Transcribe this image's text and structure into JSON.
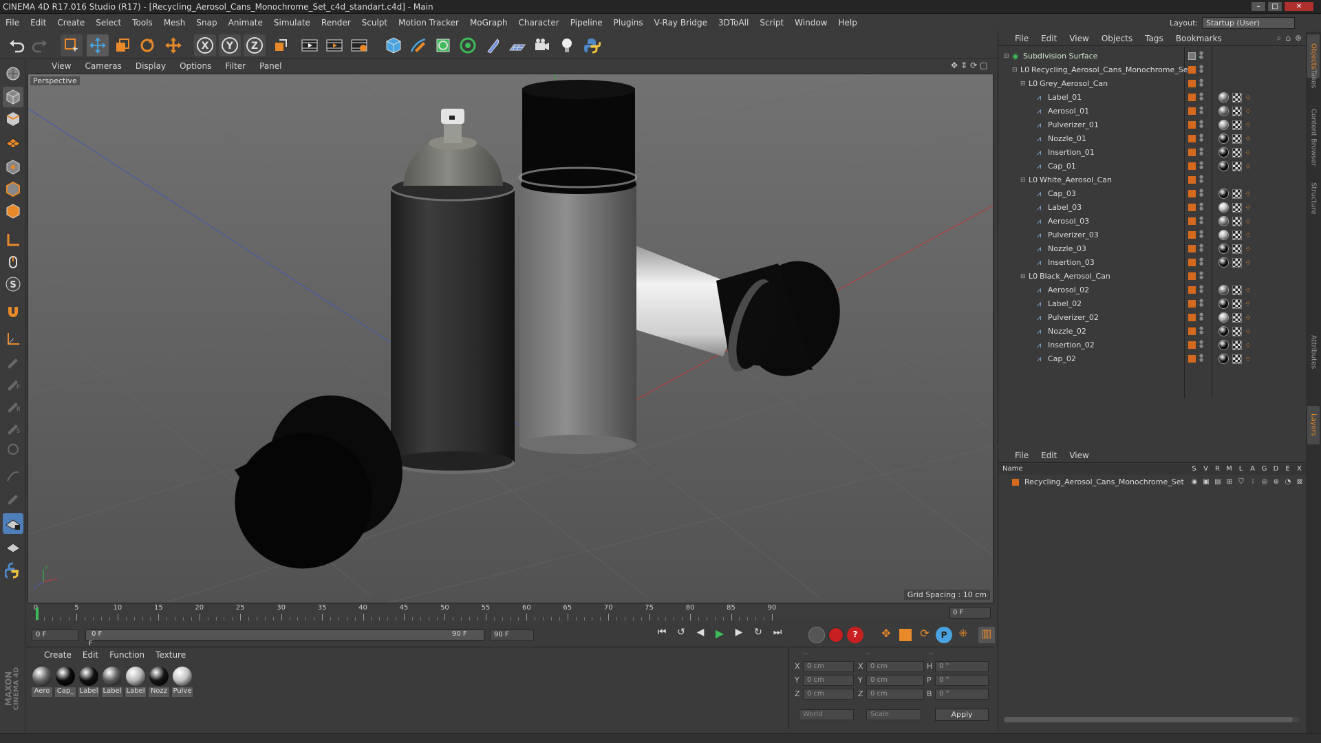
{
  "titlebar": {
    "title": "CINEMA 4D R17.016 Studio (R17) - [Recycling_Aerosol_Cans_Monochrome_Set_c4d_standart.c4d] - Main"
  },
  "menubar": [
    "File",
    "Edit",
    "Create",
    "Select",
    "Tools",
    "Mesh",
    "Snap",
    "Animate",
    "Simulate",
    "Render",
    "Sculpt",
    "Motion Tracker",
    "MoGraph",
    "Character",
    "Pipeline",
    "Plugins",
    "V-Ray Bridge",
    "3DToAll",
    "Script",
    "Window",
    "Help"
  ],
  "layout": {
    "label": "Layout:",
    "value": "Startup (User)"
  },
  "viewport": {
    "menu": [
      "View",
      "Cameras",
      "Display",
      "Options",
      "Filter",
      "Panel"
    ],
    "label": "Perspective",
    "grid_spacing": "Grid Spacing : 10 cm"
  },
  "timeline": {
    "ticks": [
      "0",
      "5",
      "10",
      "15",
      "20",
      "25",
      "30",
      "35",
      "40",
      "45",
      "50",
      "55",
      "60",
      "65",
      "70",
      "75",
      "80",
      "85",
      "90"
    ],
    "frame_field": "0 F"
  },
  "transport": {
    "start": "0 F",
    "range_start": "0 F",
    "range_end": "90 F",
    "end": "90 F"
  },
  "objects": {
    "menu": [
      "File",
      "Edit",
      "View",
      "Objects",
      "Tags",
      "Bookmarks"
    ],
    "tree": [
      {
        "name": "Subdivision Surface",
        "level": 0,
        "kind": "sds"
      },
      {
        "name": "Recycling_Aerosol_Cans_Monochrome_Set",
        "level": 1,
        "kind": "null"
      },
      {
        "name": "Grey_Aerosol_Can",
        "level": 2,
        "kind": "null"
      },
      {
        "name": "Label_01",
        "level": 3,
        "kind": "mesh",
        "tag": "#7a7a7a"
      },
      {
        "name": "Aerosol_01",
        "level": 3,
        "kind": "mesh",
        "tag": "#6a6a6a"
      },
      {
        "name": "Pulverizer_01",
        "level": 3,
        "kind": "mesh",
        "tag": "#9a9a9a"
      },
      {
        "name": "Nozzle_01",
        "level": 3,
        "kind": "mesh",
        "tag": "#111111"
      },
      {
        "name": "Insertion_01",
        "level": 3,
        "kind": "mesh",
        "tag": "#111111"
      },
      {
        "name": "Cap_01",
        "level": 3,
        "kind": "mesh",
        "tag": "#111111"
      },
      {
        "name": "White_Aerosol_Can",
        "level": 2,
        "kind": "null"
      },
      {
        "name": "Cap_03",
        "level": 3,
        "kind": "mesh",
        "tag": "#111111"
      },
      {
        "name": "Label_03",
        "level": 3,
        "kind": "mesh",
        "tag": "#bdbdbd"
      },
      {
        "name": "Aerosol_03",
        "level": 3,
        "kind": "mesh",
        "tag": "#777777"
      },
      {
        "name": "Pulverizer_03",
        "level": 3,
        "kind": "mesh",
        "tag": "#b0b0b0"
      },
      {
        "name": "Nozzle_03",
        "level": 3,
        "kind": "mesh",
        "tag": "#111111"
      },
      {
        "name": "Insertion_03",
        "level": 3,
        "kind": "mesh",
        "tag": "#111111"
      },
      {
        "name": "Black_Aerosol_Can",
        "level": 2,
        "kind": "null"
      },
      {
        "name": "Aerosol_02",
        "level": 3,
        "kind": "mesh",
        "tag": "#6a6a6a"
      },
      {
        "name": "Label_02",
        "level": 3,
        "kind": "mesh",
        "tag": "#111111"
      },
      {
        "name": "Pulverizer_02",
        "level": 3,
        "kind": "mesh",
        "tag": "#aaaaaa"
      },
      {
        "name": "Nozzle_02",
        "level": 3,
        "kind": "mesh",
        "tag": "#111111"
      },
      {
        "name": "Insertion_02",
        "level": 3,
        "kind": "mesh",
        "tag": "#111111"
      },
      {
        "name": "Cap_02",
        "level": 3,
        "kind": "mesh",
        "tag": "#111111"
      }
    ]
  },
  "layers": {
    "menu": [
      "File",
      "Edit",
      "View"
    ],
    "header": {
      "name": "Name",
      "cols": [
        "S",
        "V",
        "R",
        "M",
        "L",
        "A",
        "G",
        "D",
        "E",
        "X"
      ]
    },
    "rows": [
      {
        "name": "Recycling_Aerosol_Cans_Monochrome_Set",
        "color": "#d56a1f"
      }
    ]
  },
  "materials": {
    "menu": [
      "Create",
      "Edit",
      "Function",
      "Texture"
    ],
    "items": [
      {
        "label": "Aero",
        "color": "#666666"
      },
      {
        "label": "Cap_",
        "color": "#0b0b0b"
      },
      {
        "label": "Label",
        "color": "#111111"
      },
      {
        "label": "Label",
        "color": "#5d5d5d"
      },
      {
        "label": "Label",
        "color": "#b8b8b8"
      },
      {
        "label": "Nozz",
        "color": "#151515"
      },
      {
        "label": "Pulve",
        "color": "#c4c4c4"
      }
    ]
  },
  "coords": {
    "headers": [
      "--",
      "--",
      "--"
    ],
    "rows": [
      {
        "a": "X",
        "av": "0 cm",
        "b": "X",
        "bv": "0 cm",
        "c": "H",
        "cv": "0 °"
      },
      {
        "a": "Y",
        "av": "0 cm",
        "b": "Y",
        "bv": "0 cm",
        "c": "P",
        "cv": "0 °"
      },
      {
        "a": "Z",
        "av": "0 cm",
        "b": "Z",
        "bv": "0 cm",
        "c": "B",
        "cv": "0 °"
      }
    ],
    "space": "World",
    "mode": "Scale",
    "apply": "Apply"
  },
  "right_tabs": [
    "Objects",
    "Takes",
    "Content Browser",
    "Structure",
    "Attributes",
    "Layers"
  ],
  "brand": {
    "line1": "MAXON",
    "line2": "CINEMA 4D"
  },
  "colors": {
    "accent": "#e8892a",
    "blue": "#4aa3e0",
    "panel": "#3b3b3b"
  }
}
